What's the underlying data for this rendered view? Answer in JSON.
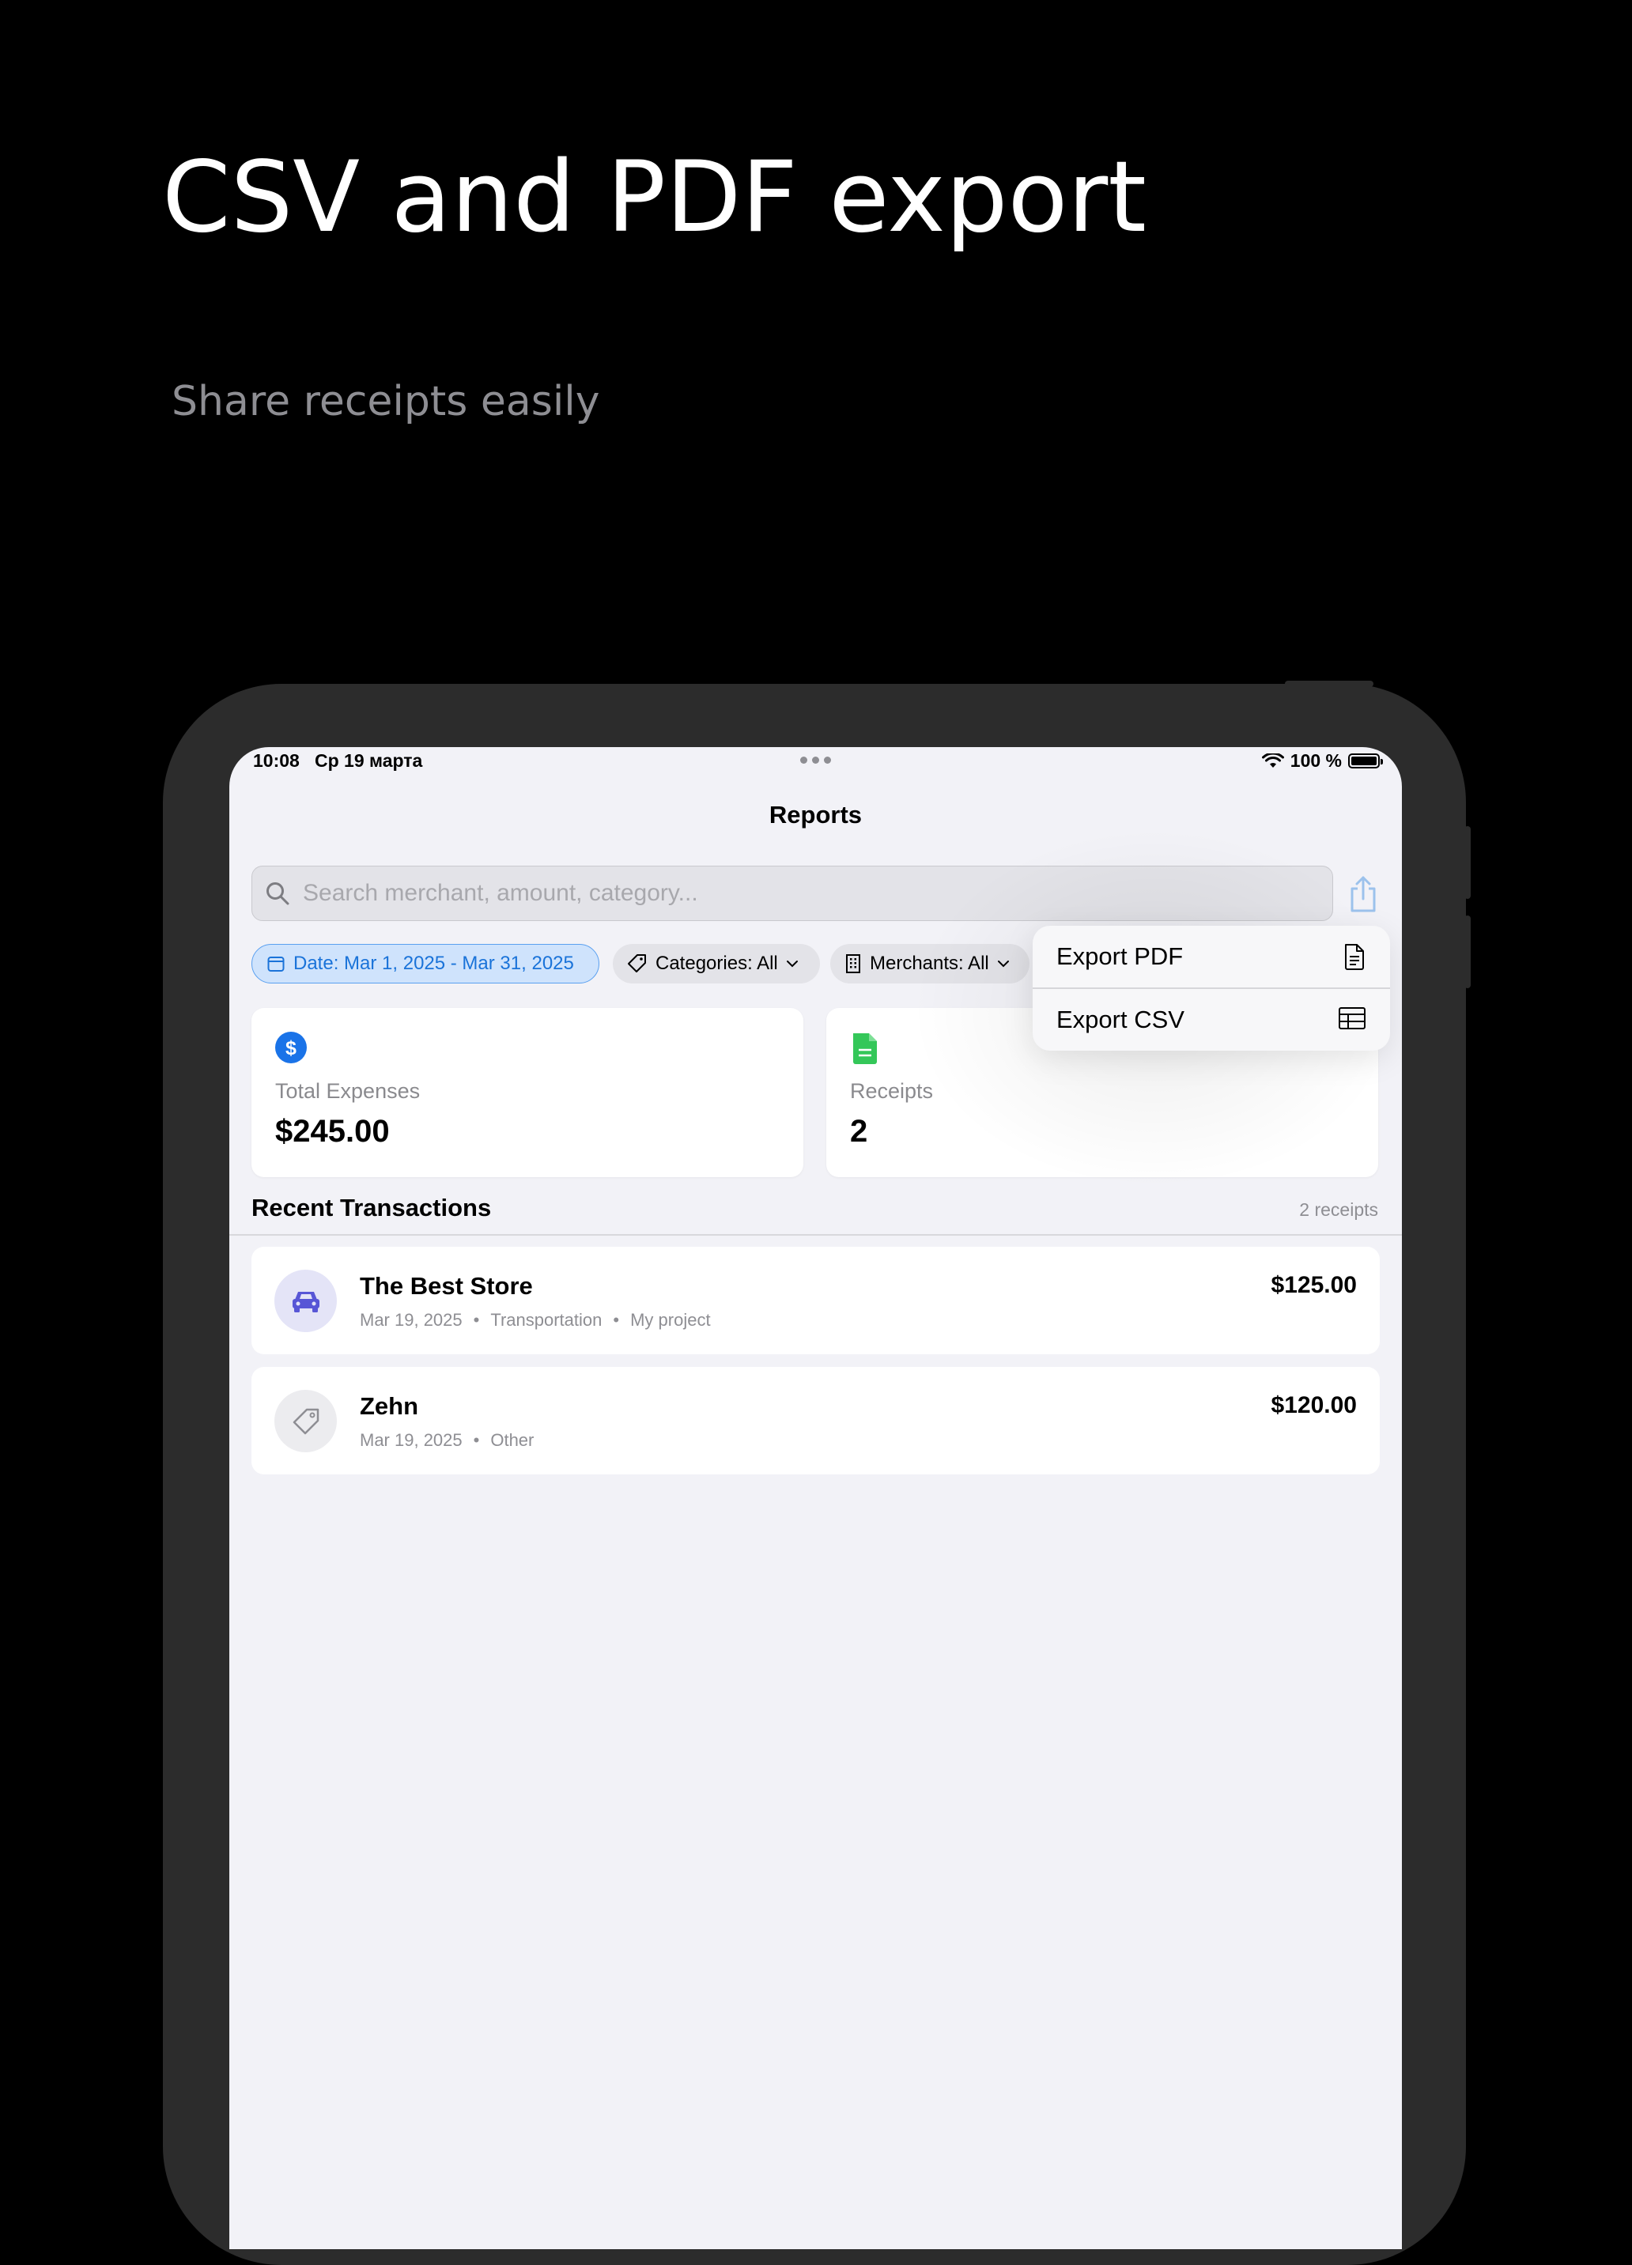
{
  "promo": {
    "headline": "CSV and PDF export",
    "subline": "Share receipts easily"
  },
  "status_bar": {
    "time": "10:08",
    "date": "Ср 19 марта",
    "battery": "100 %"
  },
  "nav": {
    "title": "Reports"
  },
  "search": {
    "placeholder": "Search merchant, amount, category..."
  },
  "filters": {
    "date": "Date: Mar 1, 2025 - Mar 31, 2025",
    "categories": "Categories: All",
    "merchants": "Merchants: All"
  },
  "summary": {
    "total_label": "Total Expenses",
    "total_value": "$245.00",
    "receipts_label": "Receipts",
    "receipts_value": "2"
  },
  "recent": {
    "title": "Recent Transactions",
    "count": "2 receipts",
    "items": [
      {
        "merchant": "The Best Store",
        "date": "Mar 19, 2025",
        "category": "Transportation",
        "project": "My project",
        "amount": "$125.00",
        "icon": "car-icon"
      },
      {
        "merchant": "Zehn",
        "date": "Mar 19, 2025",
        "category": "Other",
        "amount": "$120.00",
        "icon": "tag-icon"
      }
    ]
  },
  "export_menu": {
    "pdf": "Export PDF",
    "csv": "Export CSV"
  },
  "colors": {
    "accent": "#1a73d9",
    "receipt_green": "#34c759",
    "car_purple": "#5856d6"
  }
}
